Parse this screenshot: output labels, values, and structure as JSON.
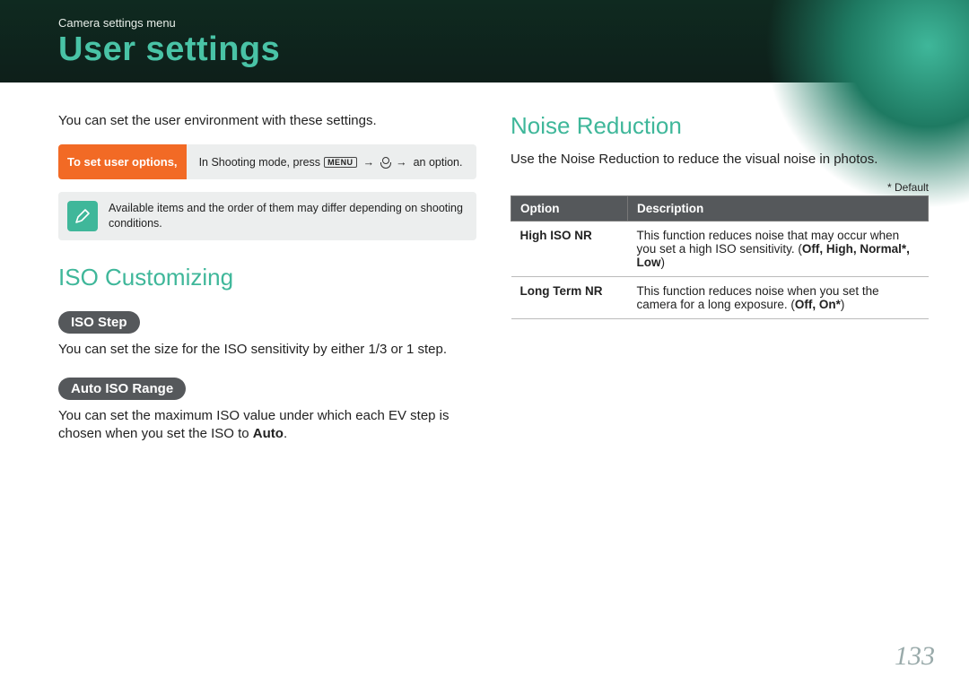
{
  "header": {
    "breadcrumb": "Camera settings menu",
    "title": "User settings"
  },
  "left": {
    "intro": "You can set the user environment with these settings.",
    "instr_tag": "To set user options,",
    "instr_lead": "In Shooting mode, press ",
    "instr_menu": "MENU",
    "instr_tail": " an option.",
    "note": "Available items and the order of them may differ depending on shooting conditions.",
    "iso_h": "ISO Customizing",
    "iso_step_pill": "ISO Step",
    "iso_step_body": "You can set the size for the ISO sensitivity by either 1/3 or 1 step.",
    "auto_iso_pill": "Auto ISO Range",
    "auto_iso_body_a": "You can set the maximum ISO value under which each EV step is chosen when you set the ISO to ",
    "auto_iso_body_b": "Auto",
    "auto_iso_body_c": "."
  },
  "right": {
    "nr_h": "Noise Reduction",
    "nr_body": "Use the Noise Reduction to reduce the visual noise in photos.",
    "default_note": "* Default",
    "th_option": "Option",
    "th_desc": "Description",
    "rows": [
      {
        "name": "High ISO NR",
        "desc_a": "This function reduces noise that may occur when you set a high ISO sensitivity. (",
        "opts": "Off, High, Normal*, Low",
        "desc_b": ")"
      },
      {
        "name": "Long Term NR",
        "desc_a": "This function reduces noise when you set the camera for a long exposure. (",
        "opts": "Off, On*",
        "desc_b": ")"
      }
    ]
  },
  "page_number": "133"
}
